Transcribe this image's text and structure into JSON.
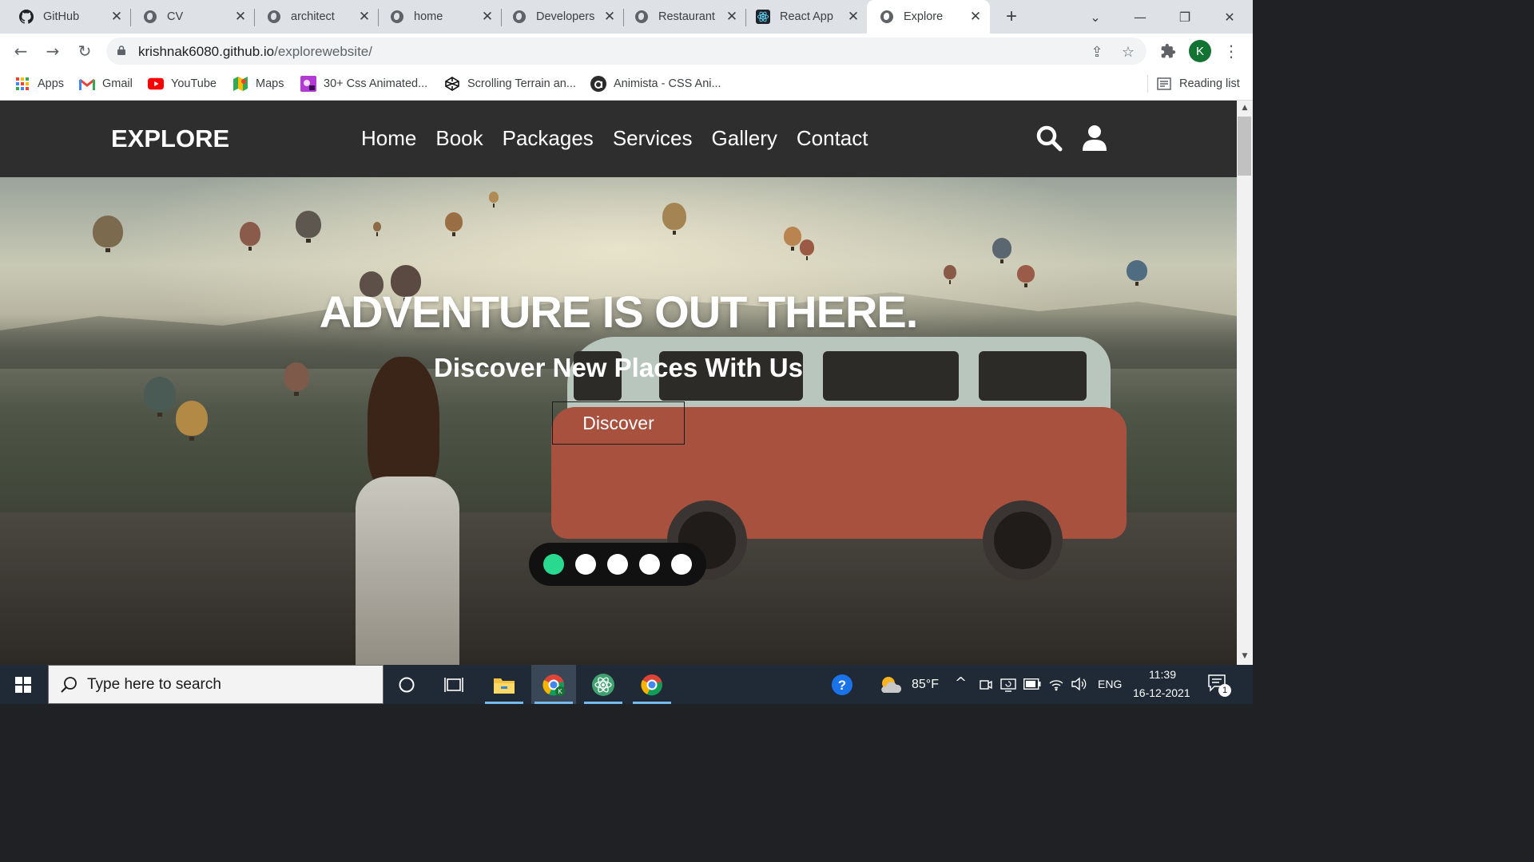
{
  "browser": {
    "tabs": [
      {
        "title": "GitHub",
        "icon": "github-icon"
      },
      {
        "title": "CV",
        "icon": "globe-icon"
      },
      {
        "title": "architect",
        "icon": "globe-icon"
      },
      {
        "title": "home",
        "icon": "globe-icon"
      },
      {
        "title": "Developers",
        "icon": "globe-icon"
      },
      {
        "title": "Restaurant",
        "icon": "globe-icon"
      },
      {
        "title": "React App",
        "icon": "react-icon"
      },
      {
        "title": "Explore",
        "icon": "globe-icon",
        "active": true
      }
    ],
    "url_host": "krishnak6080.github.io",
    "url_path": "/explorewebsite/",
    "profile_initial": "K",
    "bookmarks": [
      {
        "label": "Apps",
        "icon": "apps-grid-icon"
      },
      {
        "label": "Gmail",
        "icon": "gmail-icon"
      },
      {
        "label": "YouTube",
        "icon": "youtube-icon"
      },
      {
        "label": "Maps",
        "icon": "maps-icon"
      },
      {
        "label": "30+ Css Animated...",
        "icon": "css-animated-icon"
      },
      {
        "label": "Scrolling Terrain an...",
        "icon": "codepen-icon"
      },
      {
        "label": "Animista - CSS Ani...",
        "icon": "animista-icon"
      }
    ],
    "reading_list": "Reading list"
  },
  "site": {
    "logo": "EXPLORE",
    "nav": [
      "Home",
      "Book",
      "Packages",
      "Services",
      "Gallery",
      "Contact"
    ],
    "hero_title": "ADVENTURE IS OUT THERE.",
    "hero_subtitle": "Discover New Places With Us",
    "discover_button": "Discover",
    "slides": {
      "count": 5,
      "active_index": 0
    },
    "accent_color": "#29d98f",
    "header_color": "#2f2e2e"
  },
  "taskbar": {
    "search_placeholder": "Type here to search",
    "weather": "85°F",
    "language": "ENG",
    "time": "11:39",
    "date": "16-12-2021",
    "notification_count": "1"
  }
}
